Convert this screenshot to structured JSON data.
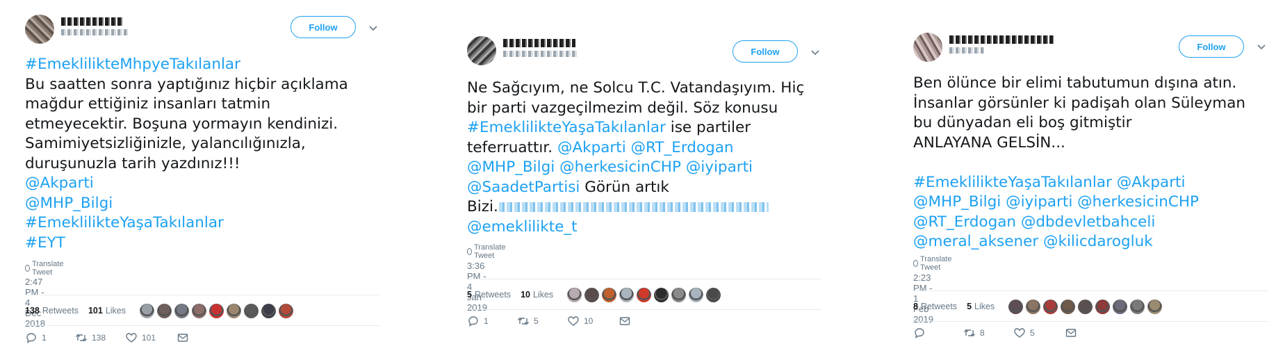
{
  "tweets": [
    {
      "follow_label": "Follow",
      "lines": [
        [
          {
            "t": "#EmeklilikteMhpyeTakılanlar",
            "l": true
          }
        ],
        [
          {
            "t": "Bu saatten sonra yaptığınız hiçbir açıklama",
            "l": false
          }
        ],
        [
          {
            "t": "mağdur ettiğiniz insanları tatmin",
            "l": false
          }
        ],
        [
          {
            "t": "etmeyecektir. Boşuna yormayın kendinizi.",
            "l": false
          }
        ],
        [
          {
            "t": "Samimiyetsizliğinizle, yalancılığınızla,",
            "l": false
          }
        ],
        [
          {
            "t": "duruşunuzla tarih yazdınız!!!",
            "l": false
          }
        ],
        [
          {
            "t": "@Akparti",
            "l": true
          }
        ],
        [
          {
            "t": "@MHP_Bilgi",
            "l": true
          }
        ],
        [
          {
            "t": "#EmeklilikteYaşaTakılanlar",
            "l": true
          }
        ],
        [
          {
            "t": "#EYT",
            "l": true
          }
        ]
      ],
      "translate_label": "Translate Tweet",
      "timestamp": "2:47 PM - 4 Dec 2018",
      "retweets_count": "138",
      "retweets_label": "Retweets",
      "likes_count": "101",
      "likes_label": "Likes",
      "replies": "1",
      "retweets_action": "138",
      "likes_action": "101",
      "avatar_colors": [
        "#9aa0a8",
        "#6f5f5a",
        "#757b86",
        "#8c6d6a",
        "#c83232",
        "#9b8770",
        "#5b5b5b",
        "#3e3e4a",
        "#b24a3a"
      ]
    },
    {
      "follow_label": "Follow",
      "lines": [
        [
          {
            "t": "Ne Sağcıyım, ne Solcu T.C. Vatandaşıyım. Hiç",
            "l": false
          }
        ],
        [
          {
            "t": "bir parti vazgeçilmezim değil. Söz konusu",
            "l": false
          }
        ],
        [
          {
            "t": "#EmeklilikteYaşaTakılanlar",
            "l": true
          },
          {
            "t": " ise partiler",
            "l": false
          }
        ],
        [
          {
            "t": "teferruattır. ",
            "l": false
          },
          {
            "t": "@Akparti @RT_Erdogan",
            "l": true
          }
        ],
        [
          {
            "t": "@MHP_Bilgi @herkesicinCHP @iyiparti",
            "l": true
          }
        ],
        [
          {
            "t": "@SaadetPartisi",
            "l": true
          },
          {
            "t": " Görün artık",
            "l": false
          }
        ],
        [
          {
            "t": "Bizi.",
            "l": false
          },
          {
            "t": "",
            "l": true,
            "blur": true
          }
        ],
        [
          {
            "t": "@emeklilikte_t",
            "l": true
          }
        ]
      ],
      "translate_label": "Translate Tweet",
      "timestamp": "3:36 PM - 4 Jan 2019",
      "retweets_count": "5",
      "retweets_label": "Retweets",
      "likes_count": "10",
      "likes_label": "Likes",
      "replies": "1",
      "retweets_action": "5",
      "likes_action": "10",
      "avatar_colors": [
        "#b7aab0",
        "#5a4a4a",
        "#c0602e",
        "#aab4be",
        "#d03a2a",
        "#2c2c2c",
        "#8a8a8a",
        "#a9b4bf",
        "#4a4a4a"
      ]
    },
    {
      "follow_label": "Follow",
      "lines": [
        [
          {
            "t": "Ben ölünce bir elimi tabutumun dışına atın.",
            "l": false
          }
        ],
        [
          {
            "t": "İnsanlar görsünler ki padişah olan Süleyman",
            "l": false
          }
        ],
        [
          {
            "t": "bu dünyadan eli boş gitmiştir",
            "l": false
          }
        ],
        [
          {
            "t": "ANLAYANA GELSİN...",
            "l": false
          }
        ],
        [
          {
            "t": "",
            "l": false
          }
        ],
        [
          {
            "t": "#EmeklilikteYaşaTakılanlar @Akparti",
            "l": true
          }
        ],
        [
          {
            "t": "@MHP_Bilgi @iyiparti @herkesicinCHP",
            "l": true
          }
        ],
        [
          {
            "t": "@RT_Erdogan @dbdevletbahceli",
            "l": true
          }
        ],
        [
          {
            "t": "@meral_aksener @kilicdarogluk",
            "l": true
          }
        ]
      ],
      "translate_label": "Translate Tweet",
      "timestamp": "2:23 PM - 1 Feb 2019",
      "retweets_count": "8",
      "retweets_label": "Retweets",
      "likes_count": "5",
      "likes_label": "Likes",
      "replies": "",
      "retweets_action": "8",
      "likes_action": "5",
      "avatar_colors": [
        "#5e4c56",
        "#8a7462",
        "#a83c3c",
        "#6f5a4a",
        "#5a5050",
        "#8c3a3a",
        "#6a6a7a",
        "#7a7a7a",
        "#9a8a70"
      ]
    }
  ]
}
